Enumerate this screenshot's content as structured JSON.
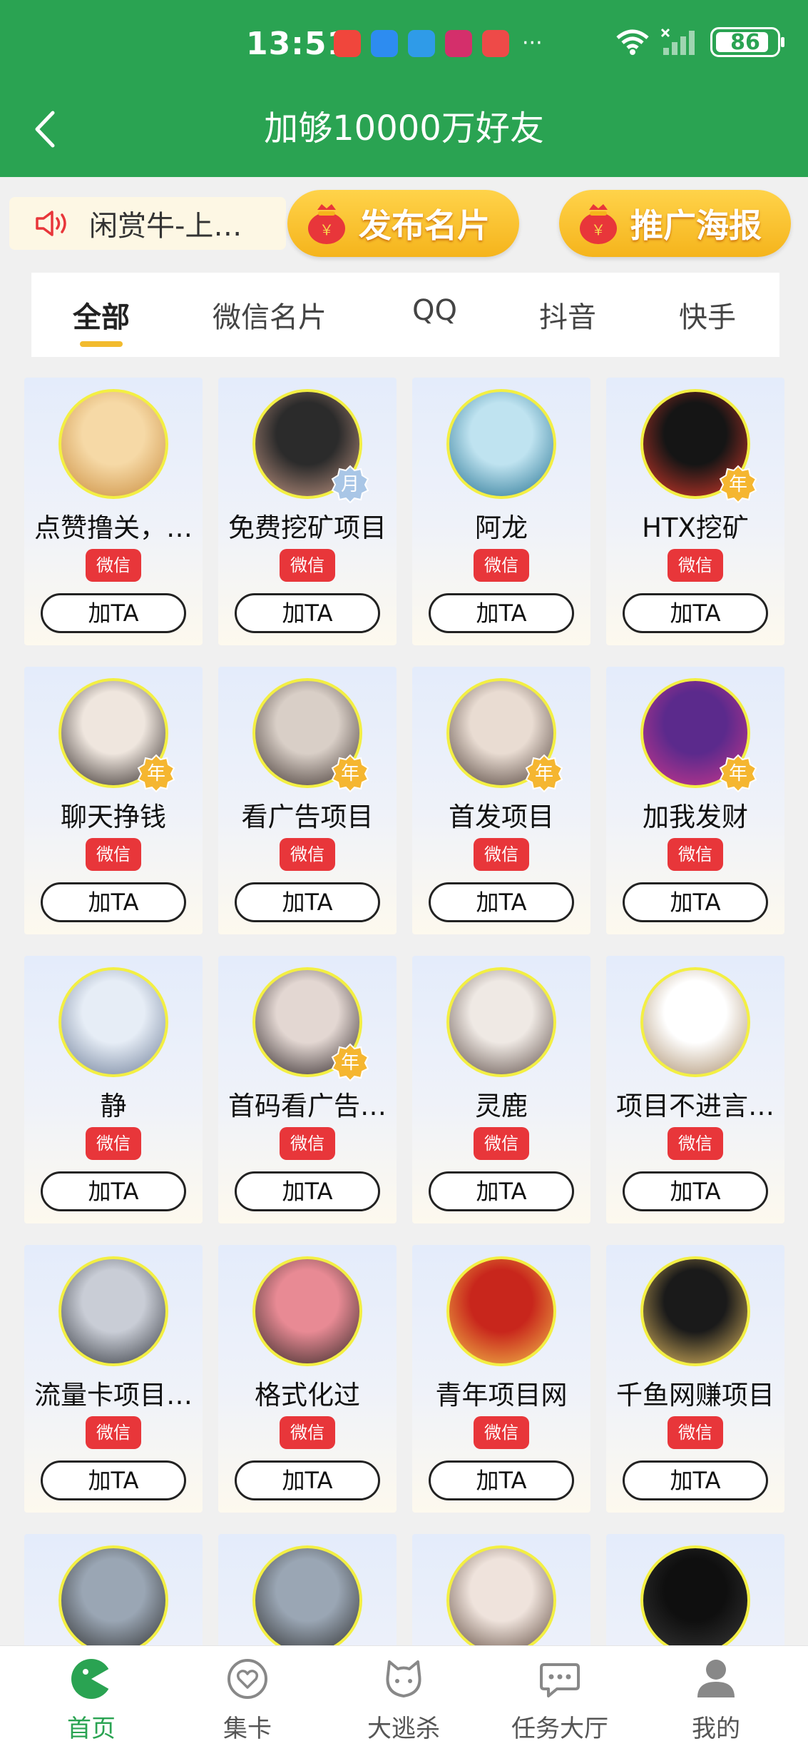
{
  "status_bar": {
    "time": "13:51",
    "battery": "86",
    "notification_colors": [
      "#f0463c",
      "#2d8cf0",
      "#2f9be8",
      "#d42f6b",
      "#ee4a48"
    ],
    "more": "···"
  },
  "header": {
    "title": "加够10000万好友"
  },
  "announcement": {
    "text": "闲赏牛-上…"
  },
  "actions": {
    "publish_card": "发布名片",
    "promo_poster": "推广海报"
  },
  "tabs": [
    {
      "label": "全部",
      "active": true
    },
    {
      "label": "微信名片",
      "active": false
    },
    {
      "label": "QQ",
      "active": false
    },
    {
      "label": "抖音",
      "active": false
    },
    {
      "label": "快手",
      "active": false
    }
  ],
  "badges": {
    "year": "年",
    "month": "月"
  },
  "users": [
    {
      "name": "点赞撸关，…",
      "tag": "微信",
      "button": "加TA",
      "badge": "",
      "avatar": [
        "#f6d9a6",
        "#c98a3a"
      ]
    },
    {
      "name": "免费挖矿项目",
      "tag": "微信",
      "button": "加TA",
      "badge": "月",
      "avatar": [
        "#2b2b2b",
        "#c99a86"
      ]
    },
    {
      "name": "阿龙",
      "tag": "微信",
      "button": "加TA",
      "badge": "",
      "avatar": [
        "#bfe3f0",
        "#1f6f8f"
      ]
    },
    {
      "name": "HTX挖矿",
      "tag": "微信",
      "button": "加TA",
      "badge": "年",
      "avatar": [
        "#151515",
        "#e03a2b"
      ]
    },
    {
      "name": "聊天挣钱",
      "tag": "微信",
      "button": "加TA",
      "badge": "年",
      "avatar": [
        "#efe6de",
        "#2a2220"
      ]
    },
    {
      "name": "看广告项目",
      "tag": "微信",
      "button": "加TA",
      "badge": "年",
      "avatar": [
        "#d9cfc7",
        "#3a2e2a"
      ]
    },
    {
      "name": "首发项目",
      "tag": "微信",
      "button": "加TA",
      "badge": "年",
      "avatar": [
        "#e9dcd2",
        "#4a3a33"
      ]
    },
    {
      "name": "加我发财",
      "tag": "微信",
      "button": "加TA",
      "badge": "年",
      "avatar": [
        "#5b2a8c",
        "#d0378b"
      ]
    },
    {
      "name": "静",
      "tag": "微信",
      "button": "加TA",
      "badge": "",
      "avatar": [
        "#e6edf6",
        "#6b7b96"
      ]
    },
    {
      "name": "首码看广告…",
      "tag": "微信",
      "button": "加TA",
      "badge": "年",
      "avatar": [
        "#e3d7d2",
        "#2a2123"
      ]
    },
    {
      "name": "灵鹿",
      "tag": "微信",
      "button": "加TA",
      "badge": "",
      "avatar": [
        "#efe9e4",
        "#5b4a44"
      ]
    },
    {
      "name": "项目不进言…",
      "tag": "微信",
      "button": "加TA",
      "badge": "",
      "avatar": [
        "#ffffff",
        "#a88a66"
      ]
    },
    {
      "name": "流量卡项目…",
      "tag": "微信",
      "button": "加TA",
      "badge": "",
      "avatar": [
        "#c9cdd6",
        "#30343b"
      ]
    },
    {
      "name": "格式化过",
      "tag": "微信",
      "button": "加TA",
      "badge": "",
      "avatar": [
        "#e88a94",
        "#2f2624"
      ]
    },
    {
      "name": "青年项目网",
      "tag": "微信",
      "button": "加TA",
      "badge": "",
      "avatar": [
        "#c8261c",
        "#f3c24a"
      ]
    },
    {
      "name": "千鱼网赚项目",
      "tag": "微信",
      "button": "加TA",
      "badge": "",
      "avatar": [
        "#1a1a1a",
        "#e9c062"
      ]
    },
    {
      "name": "",
      "tag": "",
      "button": "",
      "badge": "",
      "avatar": [
        "#9aa6b4",
        "#2b2b2b"
      ]
    },
    {
      "name": "",
      "tag": "",
      "button": "",
      "badge": "",
      "avatar": [
        "#9aa6b4",
        "#2b2b2b"
      ]
    },
    {
      "name": "",
      "tag": "",
      "button": "",
      "badge": "",
      "avatar": [
        "#efe3dc",
        "#5a4438"
      ]
    },
    {
      "name": "",
      "tag": "",
      "button": "",
      "badge": "",
      "avatar": [
        "#0f0f0f",
        "#3a3a3a"
      ]
    }
  ],
  "bottom_nav": [
    {
      "label": "首页",
      "icon": "home-icon",
      "active": true
    },
    {
      "label": "集卡",
      "icon": "card-heart-icon",
      "active": false
    },
    {
      "label": "大逃杀",
      "icon": "cat-icon",
      "active": false
    },
    {
      "label": "任务大厅",
      "icon": "chat-icon",
      "active": false
    },
    {
      "label": "我的",
      "icon": "profile-icon",
      "active": false
    }
  ],
  "colors": {
    "brand_green": "#2aa352",
    "accent_yellow": "#f5b41c",
    "tag_red": "#e8363a"
  }
}
